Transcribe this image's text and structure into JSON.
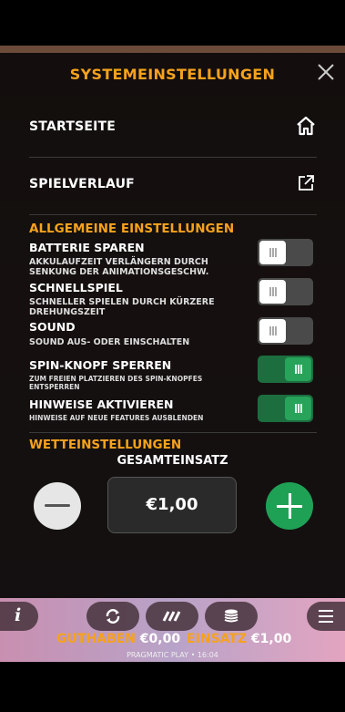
{
  "settings": {
    "title": "SYSTEMEINSTELLUNGEN",
    "links": [
      {
        "label": "STARTSEITE",
        "icon": "home-icon"
      },
      {
        "label": "SPIELVERLAUF",
        "icon": "external-link-icon"
      }
    ],
    "general_section": "ALLGEMEINE EINSTELLUNGEN",
    "options": [
      {
        "title": "BATTERIE SPAREN",
        "description": "AKKULAUFZEIT VERLÄNGERN DURCH SENKUNG DER ANIMATIONSGESCHW.",
        "state": "off"
      },
      {
        "title": "SCHNELLSPIEL",
        "description": "SCHNELLER SPIELEN DURCH KÜRZERE DREHUNGSZEIT",
        "state": "off"
      },
      {
        "title": "SOUND",
        "description": "SOUND AUS- ODER EINSCHALTEN",
        "state": "off"
      },
      {
        "title": "SPIN-KNOPF SPERREN",
        "description": "ZUM FREIEN PLATZIEREN DES SPIN-KNOPFES ENTSPERREN",
        "state": "on"
      },
      {
        "title": "HINWEISE AKTIVIEREN",
        "description": "HINWEISE AUF NEUE FEATURES AUSBLENDEN",
        "state": "on"
      }
    ],
    "bet_section": "WETTEINSTELLUNGEN",
    "bet_label": "GESAMTEINSATZ",
    "bet_value": "€1,00"
  },
  "bottom": {
    "balance_label": "GUTHABEN",
    "balance_value": "€0,00",
    "stake_label": "EINSATZ",
    "stake_value": "€1,00",
    "footer": "PRAGMATIC PLAY • 16:04"
  },
  "colors": {
    "accent": "#f6a21c",
    "toggle_on": "#27a35a",
    "plus_button": "#1fa155"
  }
}
